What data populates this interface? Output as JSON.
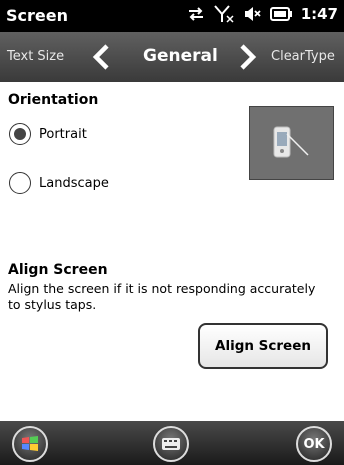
{
  "status_bar": {
    "title": "Screen",
    "time": "1:47"
  },
  "tabs": {
    "previous": "Text Size",
    "current": "General",
    "next": "ClearType"
  },
  "orientation": {
    "heading": "Orientation",
    "options": [
      {
        "label": "Portrait",
        "selected": true
      },
      {
        "label": "Landscape",
        "selected": false
      }
    ]
  },
  "align": {
    "heading": "Align Screen",
    "description": "Align the screen if it is not responding accurately to stylus taps.",
    "button_label": "Align Screen"
  },
  "bottom_bar": {
    "ok_label": "OK"
  }
}
